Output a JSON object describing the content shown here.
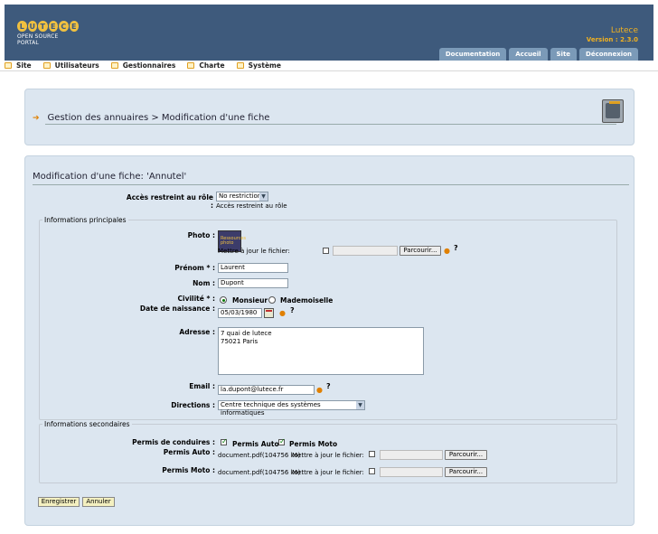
{
  "header": {
    "logo_letters": [
      "L",
      "U",
      "T",
      "E",
      "C",
      "E"
    ],
    "logo_subtitle": "OPEN SOURCE PORTAL",
    "app_name": "Lutece",
    "version": "Version : 2.3.0",
    "tabs": [
      "Documentation",
      "Accueil",
      "Site",
      "Déconnexion"
    ]
  },
  "menu": [
    "Site",
    "Utilisateurs",
    "Gestionnaires",
    "Charte",
    "Système"
  ],
  "breadcrumb": {
    "text": "Gestion des annuaires  > Modification d'une fiche"
  },
  "form": {
    "title": "Modification d'une fiche: 'Annutel'",
    "role_label": "Accès restreint au rôle :",
    "role_value": "No restriction",
    "role_hint": "Accès restreint au rôle",
    "legend_main": "Informations principales",
    "photo_label": "Photo :",
    "photo_alt": "Ressources photo",
    "update_file_label": "Mettre à jour le fichier:",
    "browse_label": "Parcourir...",
    "help": "?",
    "prenom_label": "Prénom * :",
    "prenom_value": "Laurent",
    "nom_label": "Nom :",
    "nom_value": "Dupont",
    "civilite_label": "Civilité * :",
    "civilite_options": [
      "Monsieur",
      "Mademoiselle"
    ],
    "naissance_label": "Date de naissance :",
    "naissance_value": "05/03/1980",
    "adresse_label": "Adresse :",
    "adresse_lines": [
      "7 quai de lutece",
      "75021 Paris"
    ],
    "email_label": "Email :",
    "email_value": "la.dupont@lutece.fr",
    "directions_label": "Directions :",
    "directions_value": "Centre technique des systèmes informatiques",
    "legend_secondary": "Informations secondaires",
    "permis_label": "Permis de conduires :",
    "permis_options": [
      "Permis Auto",
      "Permis Moto"
    ],
    "permis_auto_label": "Permis Auto :",
    "permis_moto_label": "Permis Moto :",
    "document_text": "document.pdf(104756 ko)",
    "save_label": "Enregistrer",
    "cancel_label": "Annuler"
  },
  "colors": {
    "header_bg": "#3e5a7c",
    "tab_bg": "#7b9ab8",
    "accent": "#f0b020",
    "panel_bg": "#dce6f0"
  }
}
